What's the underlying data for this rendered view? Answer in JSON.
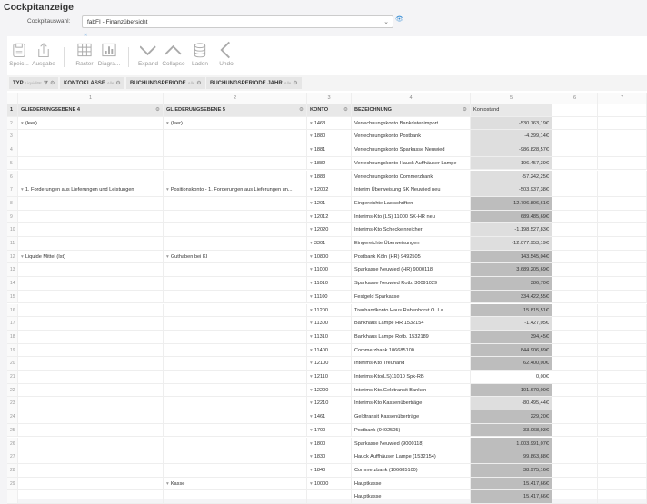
{
  "title": "Cockpitanzeige",
  "selector": {
    "label": "Cockpitauswahl:",
    "value": "fabFI - Finanzübersicht"
  },
  "toolbar": [
    {
      "label": "Speic...",
      "icon": "save-icon"
    },
    {
      "label": "Ausgabe",
      "icon": "export-icon"
    },
    {
      "label": "Raster",
      "icon": "grid-icon"
    },
    {
      "label": "Diagra...",
      "icon": "chart-icon"
    },
    {
      "label": "Expand",
      "icon": "chevron-down-icon"
    },
    {
      "label": "Collapse",
      "icon": "chevron-up-icon"
    },
    {
      "label": "Laden",
      "icon": "database-icon"
    },
    {
      "label": "Undo",
      "icon": "chevron-left-icon"
    }
  ],
  "filters": [
    {
      "name": "TYP",
      "value": "Liquidität"
    },
    {
      "name": "KONTOKLASSE",
      "value": "Alle"
    },
    {
      "name": "BUCHUNGSPERIODE",
      "value": "Alle"
    },
    {
      "name": "BUCHUNGSPERIODE JAHR",
      "value": "Alle"
    }
  ],
  "column_index": [
    "1",
    "2",
    "3",
    "4",
    "5",
    "6",
    "7"
  ],
  "headers": [
    "GLIEDERUNGSEBENE 4",
    "GLIEDERUNGSEBENE 5",
    "KONTO",
    "BEZEICHNUNG",
    "Kontostand"
  ],
  "rows": [
    {
      "n": "2",
      "g4": "(leer)",
      "g5": "(leer)",
      "konto": "1463",
      "bez": "Verrechnungskonto Bankdatenimport",
      "val": "-530.763,19€",
      "s": "neg"
    },
    {
      "n": "3",
      "g4": "",
      "g5": "",
      "konto": "1880",
      "bez": "Verrechnungskonto Postbank",
      "val": "-4.399,14€",
      "s": "neg"
    },
    {
      "n": "4",
      "g4": "",
      "g5": "",
      "konto": "1881",
      "bez": "Verrechnungskonto Sparkasse Neuwied",
      "val": "-986.828,57€",
      "s": "neg"
    },
    {
      "n": "5",
      "g4": "",
      "g5": "",
      "konto": "1882",
      "bez": "Verrechnungskonto Hauck Auffhäuser Lampe",
      "val": "-196.457,39€",
      "s": "neg"
    },
    {
      "n": "6",
      "g4": "",
      "g5": "",
      "konto": "1883",
      "bez": "Verrechnungskonto Commerzbank",
      "val": "-57.242,25€",
      "s": "neg"
    },
    {
      "n": "7",
      "g4": "1. Forderungen aus Lieferungen und Leistungen",
      "g5": "Positionskonto - 1. Forderungen aus Lieferungen un...",
      "konto": "12002",
      "bez": "Interim Überweisung SK Neuwied neu",
      "val": "-503.937,38€",
      "s": "neg"
    },
    {
      "n": "8",
      "g4": "",
      "g5": "",
      "konto": "1201",
      "bez": "Eingereichte Lastschriften",
      "val": "12.706.806,61€",
      "s": "pos"
    },
    {
      "n": "9",
      "g4": "",
      "g5": "",
      "konto": "12012",
      "bez": "Interims-Kto (LS) 11000 SK-HR neu",
      "val": "689.485,69€",
      "s": "pos"
    },
    {
      "n": "10",
      "g4": "",
      "g5": "",
      "konto": "12020",
      "bez": "Interims-Kto Scheckeinreicher",
      "val": "-1.198.527,83€",
      "s": "neg"
    },
    {
      "n": "11",
      "g4": "",
      "g5": "",
      "konto": "3301",
      "bez": "Eingereichte Überweisungen",
      "val": "-12.077.953,19€",
      "s": "neg"
    },
    {
      "n": "12",
      "g4": "Liquide Mittel (Ist)",
      "g5": "Guthaben bei KI",
      "konto": "10800",
      "bez": "Postbank Köln  (HR) 9492505",
      "val": "143.545,04€",
      "s": "pos"
    },
    {
      "n": "13",
      "g4": "",
      "g5": "",
      "konto": "11000",
      "bez": "Sparkasse Neuwied (HR) 9000118",
      "val": "3.689.205,69€",
      "s": "pos"
    },
    {
      "n": "14",
      "g4": "",
      "g5": "",
      "konto": "11010",
      "bez": "Sparkasse Neuwied Rotb. 30091029",
      "val": "386,70€",
      "s": "pos"
    },
    {
      "n": "15",
      "g4": "",
      "g5": "",
      "konto": "11100",
      "bez": "Festgeld Sparkasse",
      "val": "334.422,55€",
      "s": "pos"
    },
    {
      "n": "16",
      "g4": "",
      "g5": "",
      "konto": "11200",
      "bez": "Treuhandkonto Haus Rabenhorst O. La",
      "val": "15.815,51€",
      "s": "pos"
    },
    {
      "n": "17",
      "g4": "",
      "g5": "",
      "konto": "11300",
      "bez": "Bankhaus Lampe HR 1532154",
      "val": "-1.427,05€",
      "s": "neg"
    },
    {
      "n": "18",
      "g4": "",
      "g5": "",
      "konto": "11310",
      "bez": "Bankhaus Lampe Rotb. 1532189",
      "val": "394,45€",
      "s": "pos"
    },
    {
      "n": "19",
      "g4": "",
      "g5": "",
      "konto": "11400",
      "bez": "Commerzbank 106685100",
      "val": "844.906,89€",
      "s": "pos"
    },
    {
      "n": "20",
      "g4": "",
      "g5": "",
      "konto": "12100",
      "bez": "Interims-Kto Treuhand",
      "val": "62.400,00€",
      "s": "pos"
    },
    {
      "n": "21",
      "g4": "",
      "g5": "",
      "konto": "12110",
      "bez": "Interims-Kto(LS)11010 Spk-RB",
      "val": "0,00€",
      "s": "zero"
    },
    {
      "n": "22",
      "g4": "",
      "g5": "",
      "konto": "12200",
      "bez": "Interims-Kto.Geldtransit Banken",
      "val": "101.670,00€",
      "s": "pos"
    },
    {
      "n": "23",
      "g4": "",
      "g5": "",
      "konto": "12210",
      "bez": "Interims-Kto Kassenüberträge",
      "val": "-80.495,44€",
      "s": "neg"
    },
    {
      "n": "24",
      "g4": "",
      "g5": "",
      "konto": "1461",
      "bez": "Geldtransit Kassenüberträge",
      "val": "229,20€",
      "s": "pos"
    },
    {
      "n": "25",
      "g4": "",
      "g5": "",
      "konto": "1700",
      "bez": "Postbank (9492505)",
      "val": "33.068,93€",
      "s": "pos"
    },
    {
      "n": "26",
      "g4": "",
      "g5": "",
      "konto": "1800",
      "bez": "Sparkasse Neuwied (9000118)",
      "val": "1.003.991,07€",
      "s": "pos"
    },
    {
      "n": "27",
      "g4": "",
      "g5": "",
      "konto": "1830",
      "bez": "Hauck Auffhäuser Lampe (1532154)",
      "val": "99.863,88€",
      "s": "pos"
    },
    {
      "n": "28",
      "g4": "",
      "g5": "",
      "konto": "1840",
      "bez": "Commerzbank (106685100)",
      "val": "38.975,16€",
      "s": "pos"
    },
    {
      "n": "29",
      "g4": "",
      "g5": "Kasse",
      "konto": "10000",
      "bez": "Hauptkasse",
      "val": "15.417,66€",
      "s": "pos"
    },
    {
      "n": "",
      "g4": "",
      "g5": "",
      "konto": "",
      "bez": "Hauptkasse",
      "val": "15.417,66€",
      "s": "pos"
    }
  ]
}
